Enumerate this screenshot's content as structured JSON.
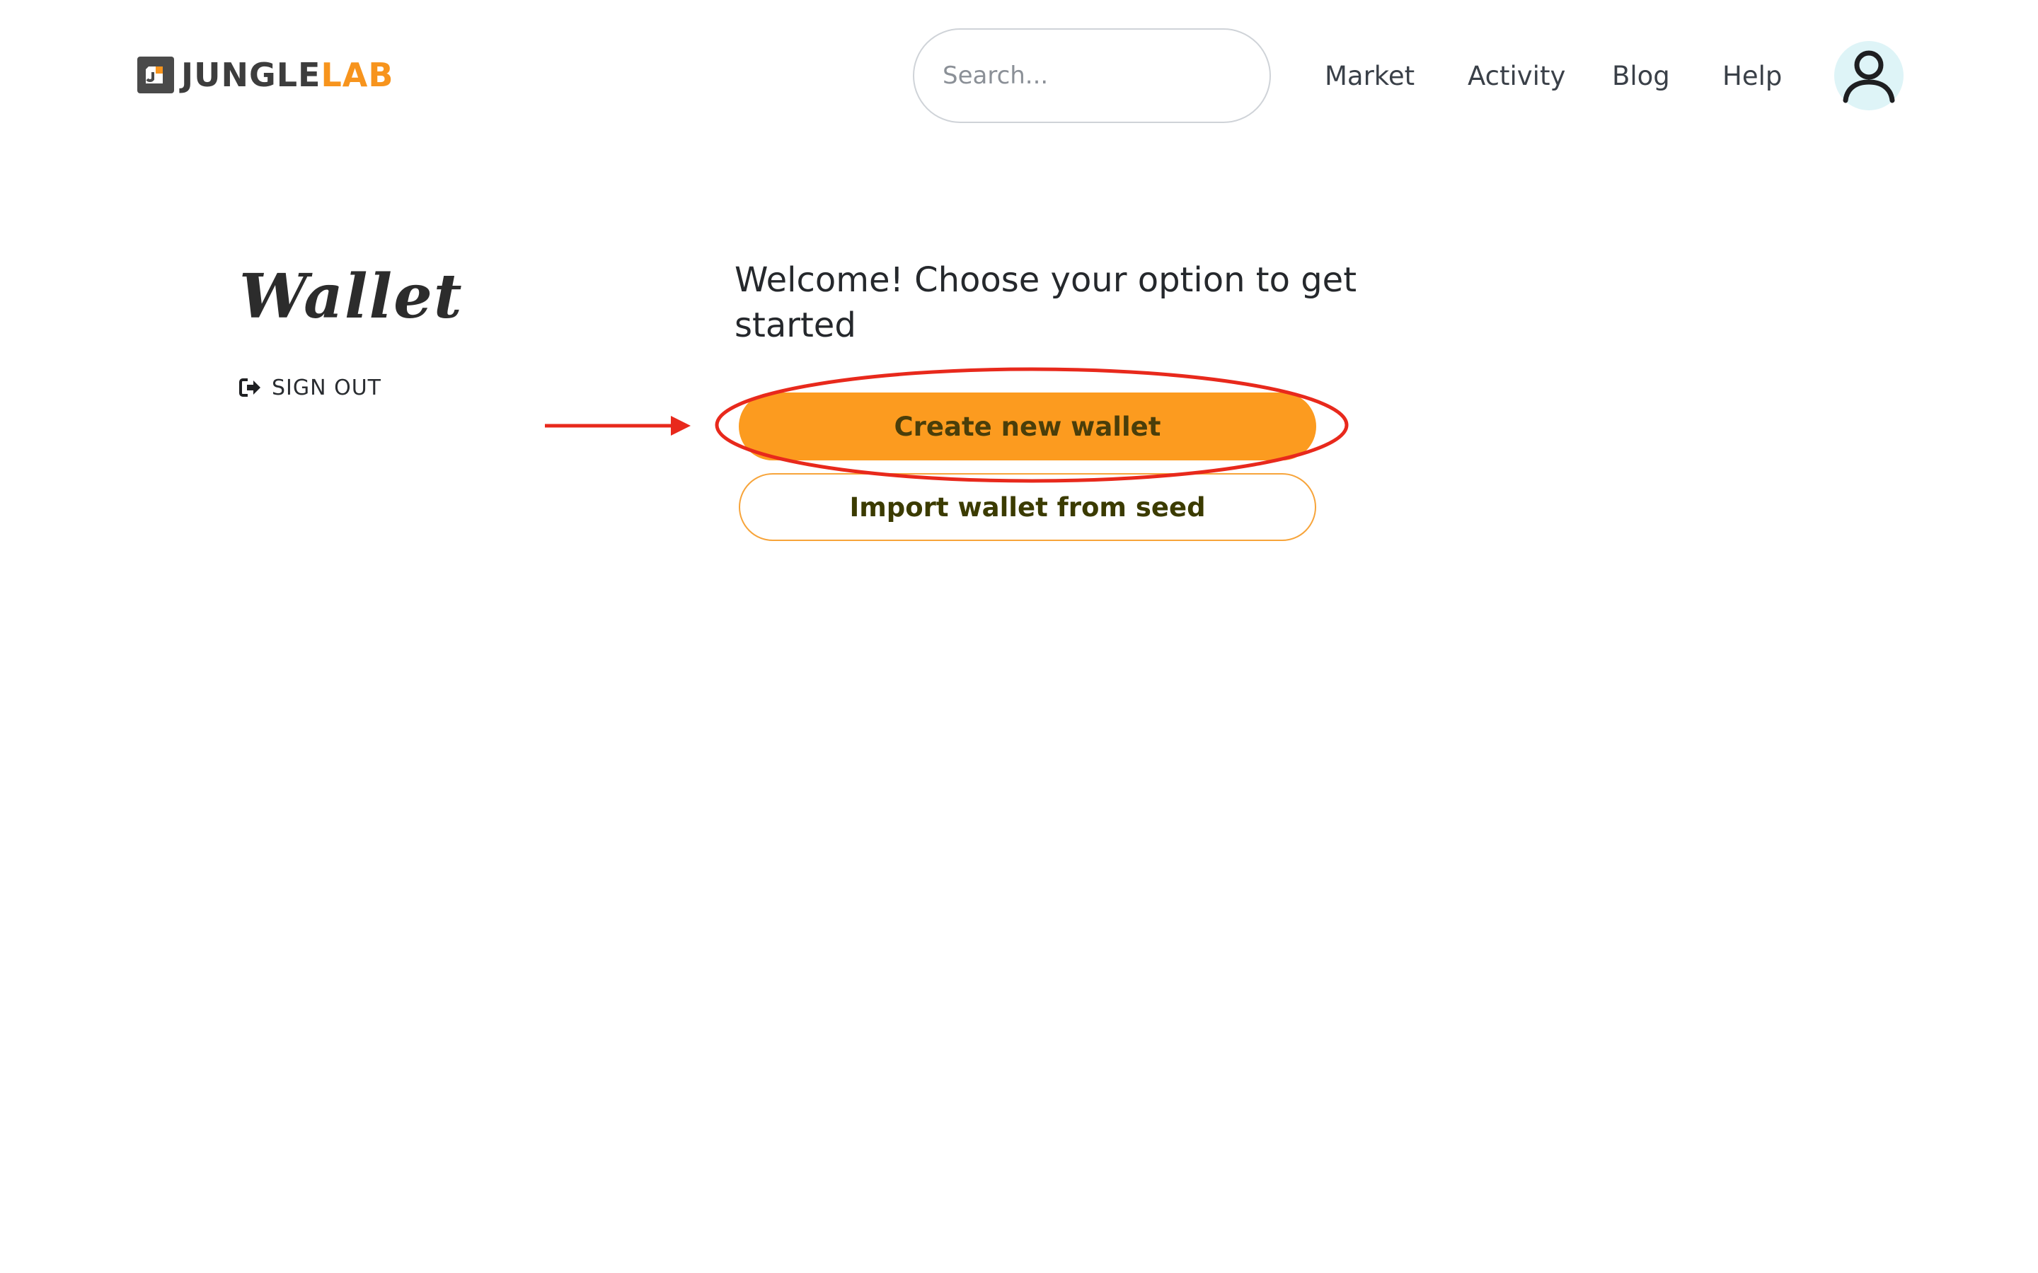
{
  "header": {
    "logo": {
      "part1": "JUNGLE",
      "part2": "LAB",
      "icon": "junglelab-logo-icon"
    },
    "search": {
      "placeholder": "Search...",
      "icon": "search-icon"
    },
    "nav": [
      "Market",
      "Activity",
      "Blog",
      "Help"
    ],
    "avatar_icon": "user-avatar-icon"
  },
  "sidebar": {
    "title": "Wallet",
    "signout_label": "SIGN OUT",
    "signout_icon": "sign-out-icon"
  },
  "main": {
    "welcome": "Welcome! Choose your option to get started",
    "create_label": "Create new wallet",
    "import_label": "Import wallet from seed"
  },
  "annotation": {
    "arrow_icon": "arrow-right-icon",
    "highlight": "ellipse-highlight",
    "color": "#e8291c"
  },
  "colors": {
    "accent": "#fc9b1f",
    "logo_accent": "#f7941d",
    "button_text": "#4a3e0a",
    "avatar_bg": "#def4f7"
  }
}
